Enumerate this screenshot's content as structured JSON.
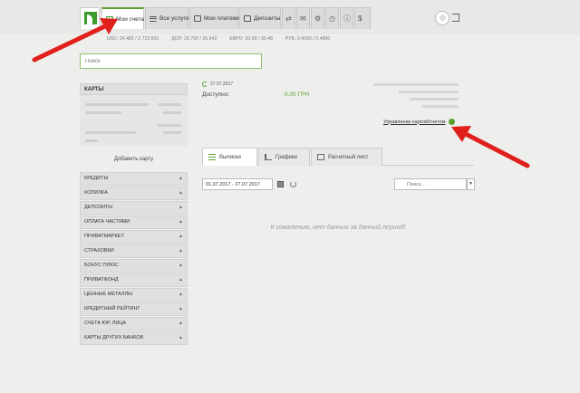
{
  "nav": {
    "tabs": [
      {
        "label": "Мои счета",
        "icon": "card-icon",
        "active": true
      },
      {
        "label": "Все услуги",
        "icon": "list-icon"
      },
      {
        "label": "Мои платежи",
        "icon": "payments-icon"
      },
      {
        "label": "Депозиты",
        "icon": "deposit-icon"
      }
    ],
    "extra_icons": [
      "transfer-icon",
      "mail-icon",
      "clock-icon",
      "info-icon",
      "cash-icon"
    ]
  },
  "rates": {
    "usd": "USD: 24.482 / 2 723.601",
    "dol": "ДОЛ: 26.700 / 26.642",
    "euro": "ЕВРО: 30.00 / 30.48",
    "rub": "РУБ: 0.4200 / 0.4800"
  },
  "search": {
    "placeholder": "Поиск"
  },
  "sidebar": {
    "cards_title": "КАРТЫ",
    "add_card": "Добавить карту",
    "menu": [
      "КРЕДИТЫ",
      "КОПИЛКА",
      "ДЕПОЗИТЫ",
      "ОПЛАТА ЧАСТЯМИ",
      "ПРИВАТМАРКЕТ",
      "СТРАХОВКИ",
      "БОНУС ПЛЮС",
      "ПРИВАТФОНД",
      "ЦЕННЫЕ МЕТАЛЛЫ",
      "КРЕДИТНЫЙ РЕЙТИНГ",
      "СЧЕТА ЮР. ЛИЦА",
      "КАРТЫ ДРУГИХ БАНКОВ"
    ]
  },
  "account": {
    "date": "27.07.2017",
    "available_label": "Доступно:",
    "available_value": "0.00",
    "currency": "ГРН",
    "manage_link": "Управление картой/счетом"
  },
  "content_tabs": [
    {
      "label": "Выписки",
      "active": true
    },
    {
      "label": "Графики"
    },
    {
      "label": "Расчетный лист"
    }
  ],
  "filters": {
    "date_range": "01.07.2017 - 27.07.2017",
    "search_placeholder": "Поиск..."
  },
  "empty_message": "К сожалению, нет данных за данный период!",
  "colors": {
    "accent": "#5aa02c",
    "annotation_arrow": "#e0201b"
  }
}
